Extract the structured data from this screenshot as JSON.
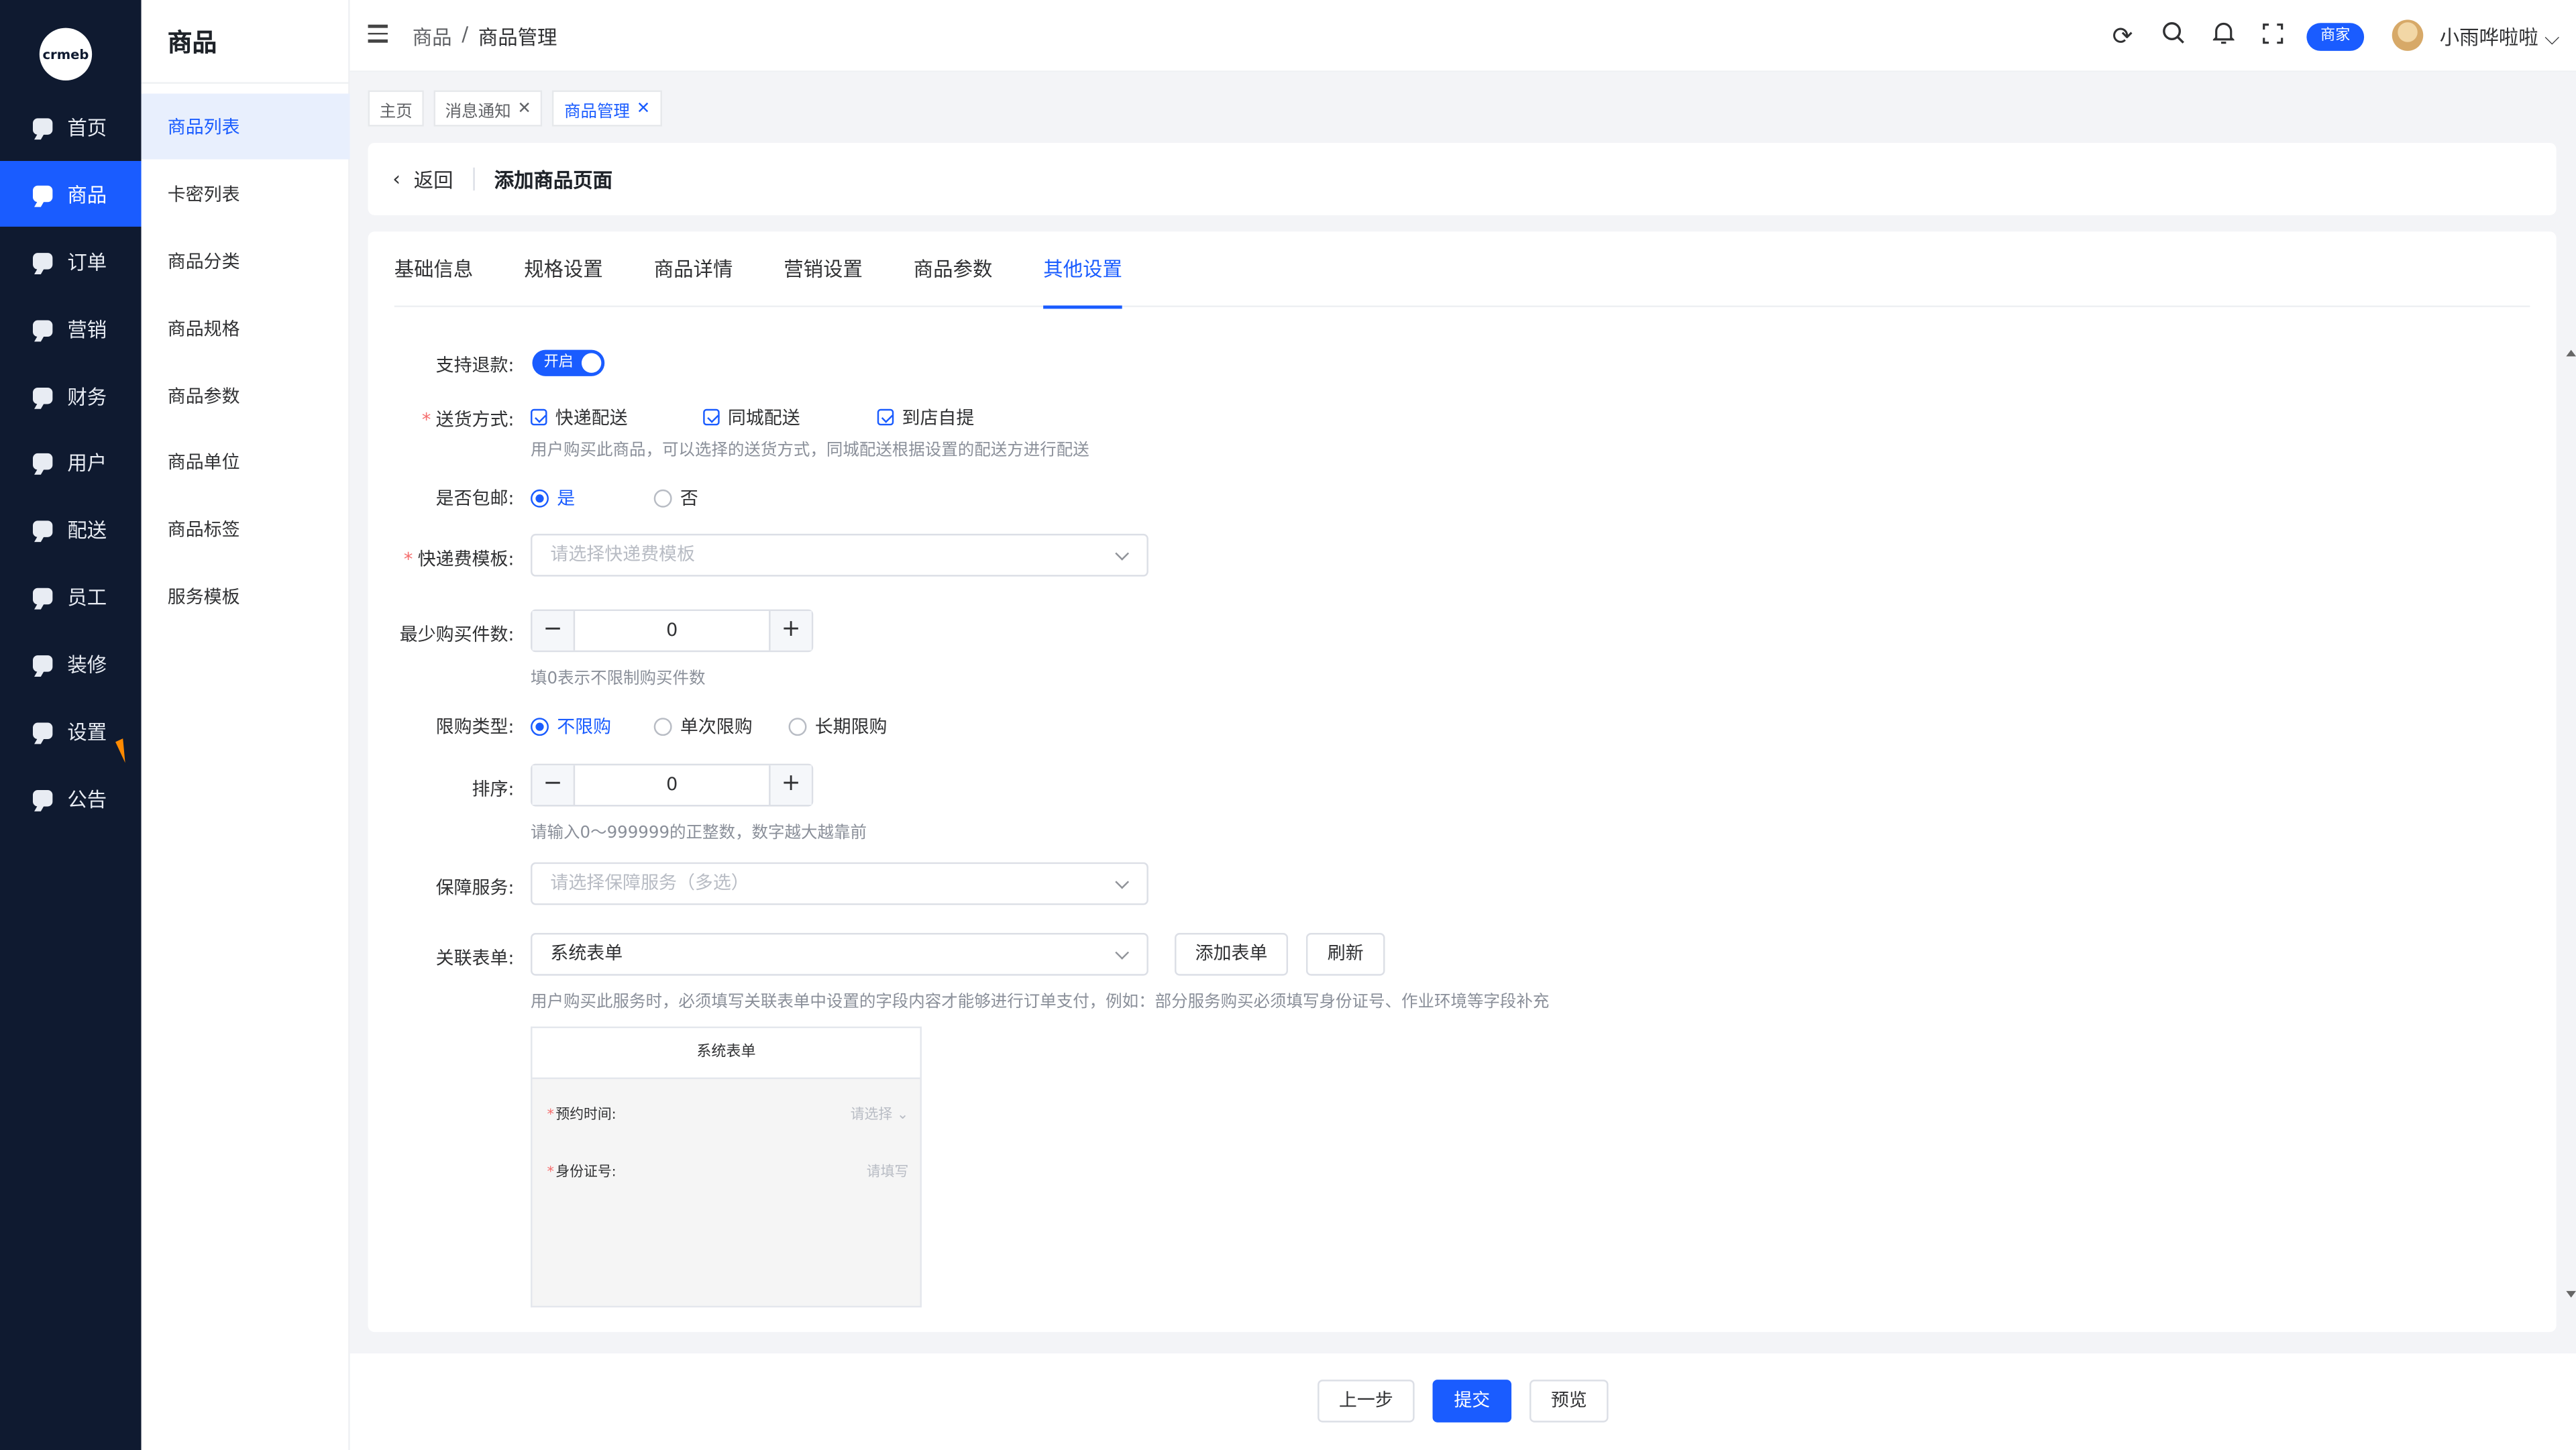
{
  "logo": {
    "text": "crmeb"
  },
  "nav": {
    "items": [
      {
        "label": "首页"
      },
      {
        "label": "商品"
      },
      {
        "label": "订单"
      },
      {
        "label": "营销"
      },
      {
        "label": "财务"
      },
      {
        "label": "用户"
      },
      {
        "label": "配送"
      },
      {
        "label": "员工"
      },
      {
        "label": "装修"
      },
      {
        "label": "设置"
      },
      {
        "label": "公告"
      }
    ],
    "active": "商品"
  },
  "subnav": {
    "title": "商品",
    "items": [
      {
        "label": "商品列表"
      },
      {
        "label": "卡密列表"
      },
      {
        "label": "商品分类"
      },
      {
        "label": "商品规格"
      },
      {
        "label": "商品参数"
      },
      {
        "label": "商品单位"
      },
      {
        "label": "商品标签"
      },
      {
        "label": "服务模板"
      }
    ],
    "active": "商品列表"
  },
  "header": {
    "breadcrumb": [
      "商品",
      "/",
      "商品管理"
    ],
    "badge": "商家",
    "user": "小雨哗啦啦",
    "icons": [
      "refresh-icon",
      "search-icon",
      "bell-icon",
      "fullscreen-icon"
    ]
  },
  "tags": [
    {
      "label": "主页"
    },
    {
      "label": "消息通知"
    },
    {
      "label": "商品管理"
    }
  ],
  "page": {
    "back": "返回",
    "title": "添加商品页面"
  },
  "tabs": [
    "基础信息",
    "规格设置",
    "商品详情",
    "营销设置",
    "商品参数",
    "其他设置"
  ],
  "active_tab": "其他设置",
  "form": {
    "refund": {
      "label": "支持退款:",
      "switch_text": "开启",
      "on": true
    },
    "delivery": {
      "label": "送货方式:",
      "options": [
        "快递配送",
        "同城配送",
        "到店自提"
      ],
      "hint": "用户购买此商品，可以选择的送货方式，同城配送根据设置的配送方进行配送"
    },
    "free_shipping": {
      "label": "是否包邮:",
      "options": [
        "是",
        "否"
      ],
      "selected": "是"
    },
    "shipping_template": {
      "label": "快递费模板:",
      "placeholder": "请选择快递费模板"
    },
    "min_qty": {
      "label": "最少购买件数:",
      "value": "0",
      "hint": "填0表示不限制购买件数"
    },
    "limit_type": {
      "label": "限购类型:",
      "options": [
        "不限购",
        "单次限购",
        "长期限购"
      ],
      "selected": "不限购"
    },
    "sort": {
      "label": "排序:",
      "value": "0",
      "hint": "请输入0～999999的正整数，数字越大越靠前"
    },
    "guarantee": {
      "label": "保障服务:",
      "placeholder": "请选择保障服务（多选）"
    },
    "linked_form": {
      "label": "关联表单:",
      "value": "系统表单",
      "add_button": "添加表单",
      "refresh_button": "刷新",
      "hint": "用户购买此服务时，必须填写关联表单中设置的字段内容才能够进行订单支付，例如：部分服务购买必须填写身份证号、作业环境等字段补充"
    },
    "preview": {
      "title": "系统表单",
      "fields": [
        {
          "label": "预约时间:",
          "placeholder": "请选择"
        },
        {
          "label": "身份证号:",
          "placeholder": "请填写"
        }
      ]
    }
  },
  "footer": {
    "prev": "上一步",
    "submit": "提交",
    "preview": "预览"
  }
}
